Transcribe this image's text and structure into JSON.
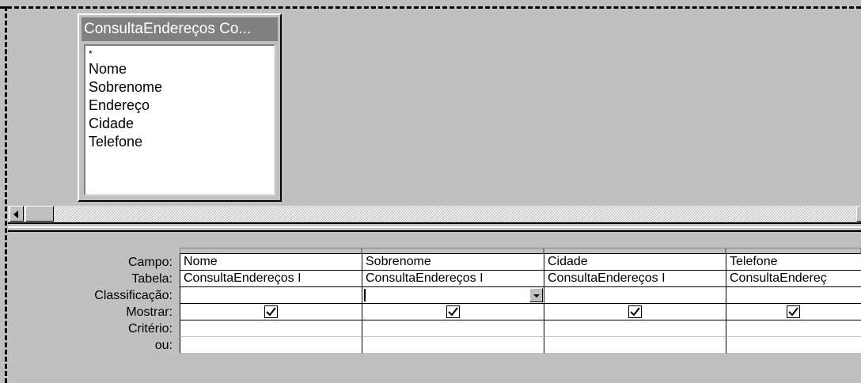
{
  "field_list": {
    "title": "ConsultaEndereços Co...",
    "items": [
      "*",
      "Nome",
      "Sobrenome",
      "Endereço",
      "Cidade",
      "Telefone"
    ]
  },
  "row_labels": [
    "Campo:",
    "Tabela:",
    "Classificação:",
    "Mostrar:",
    "Critério:",
    "ou:"
  ],
  "columns": [
    {
      "campo": "Nome",
      "tabela": "ConsultaEndereços I",
      "classificacao": "",
      "mostrar": true
    },
    {
      "campo": "Sobrenome",
      "tabela": "ConsultaEndereços I",
      "classificacao": "",
      "mostrar": true
    },
    {
      "campo": "Cidade",
      "tabela": "ConsultaEndereços I",
      "classificacao": "",
      "mostrar": true
    },
    {
      "campo": "Telefone",
      "tabela": "ConsultaEndereç",
      "classificacao": "",
      "mostrar": true
    }
  ]
}
